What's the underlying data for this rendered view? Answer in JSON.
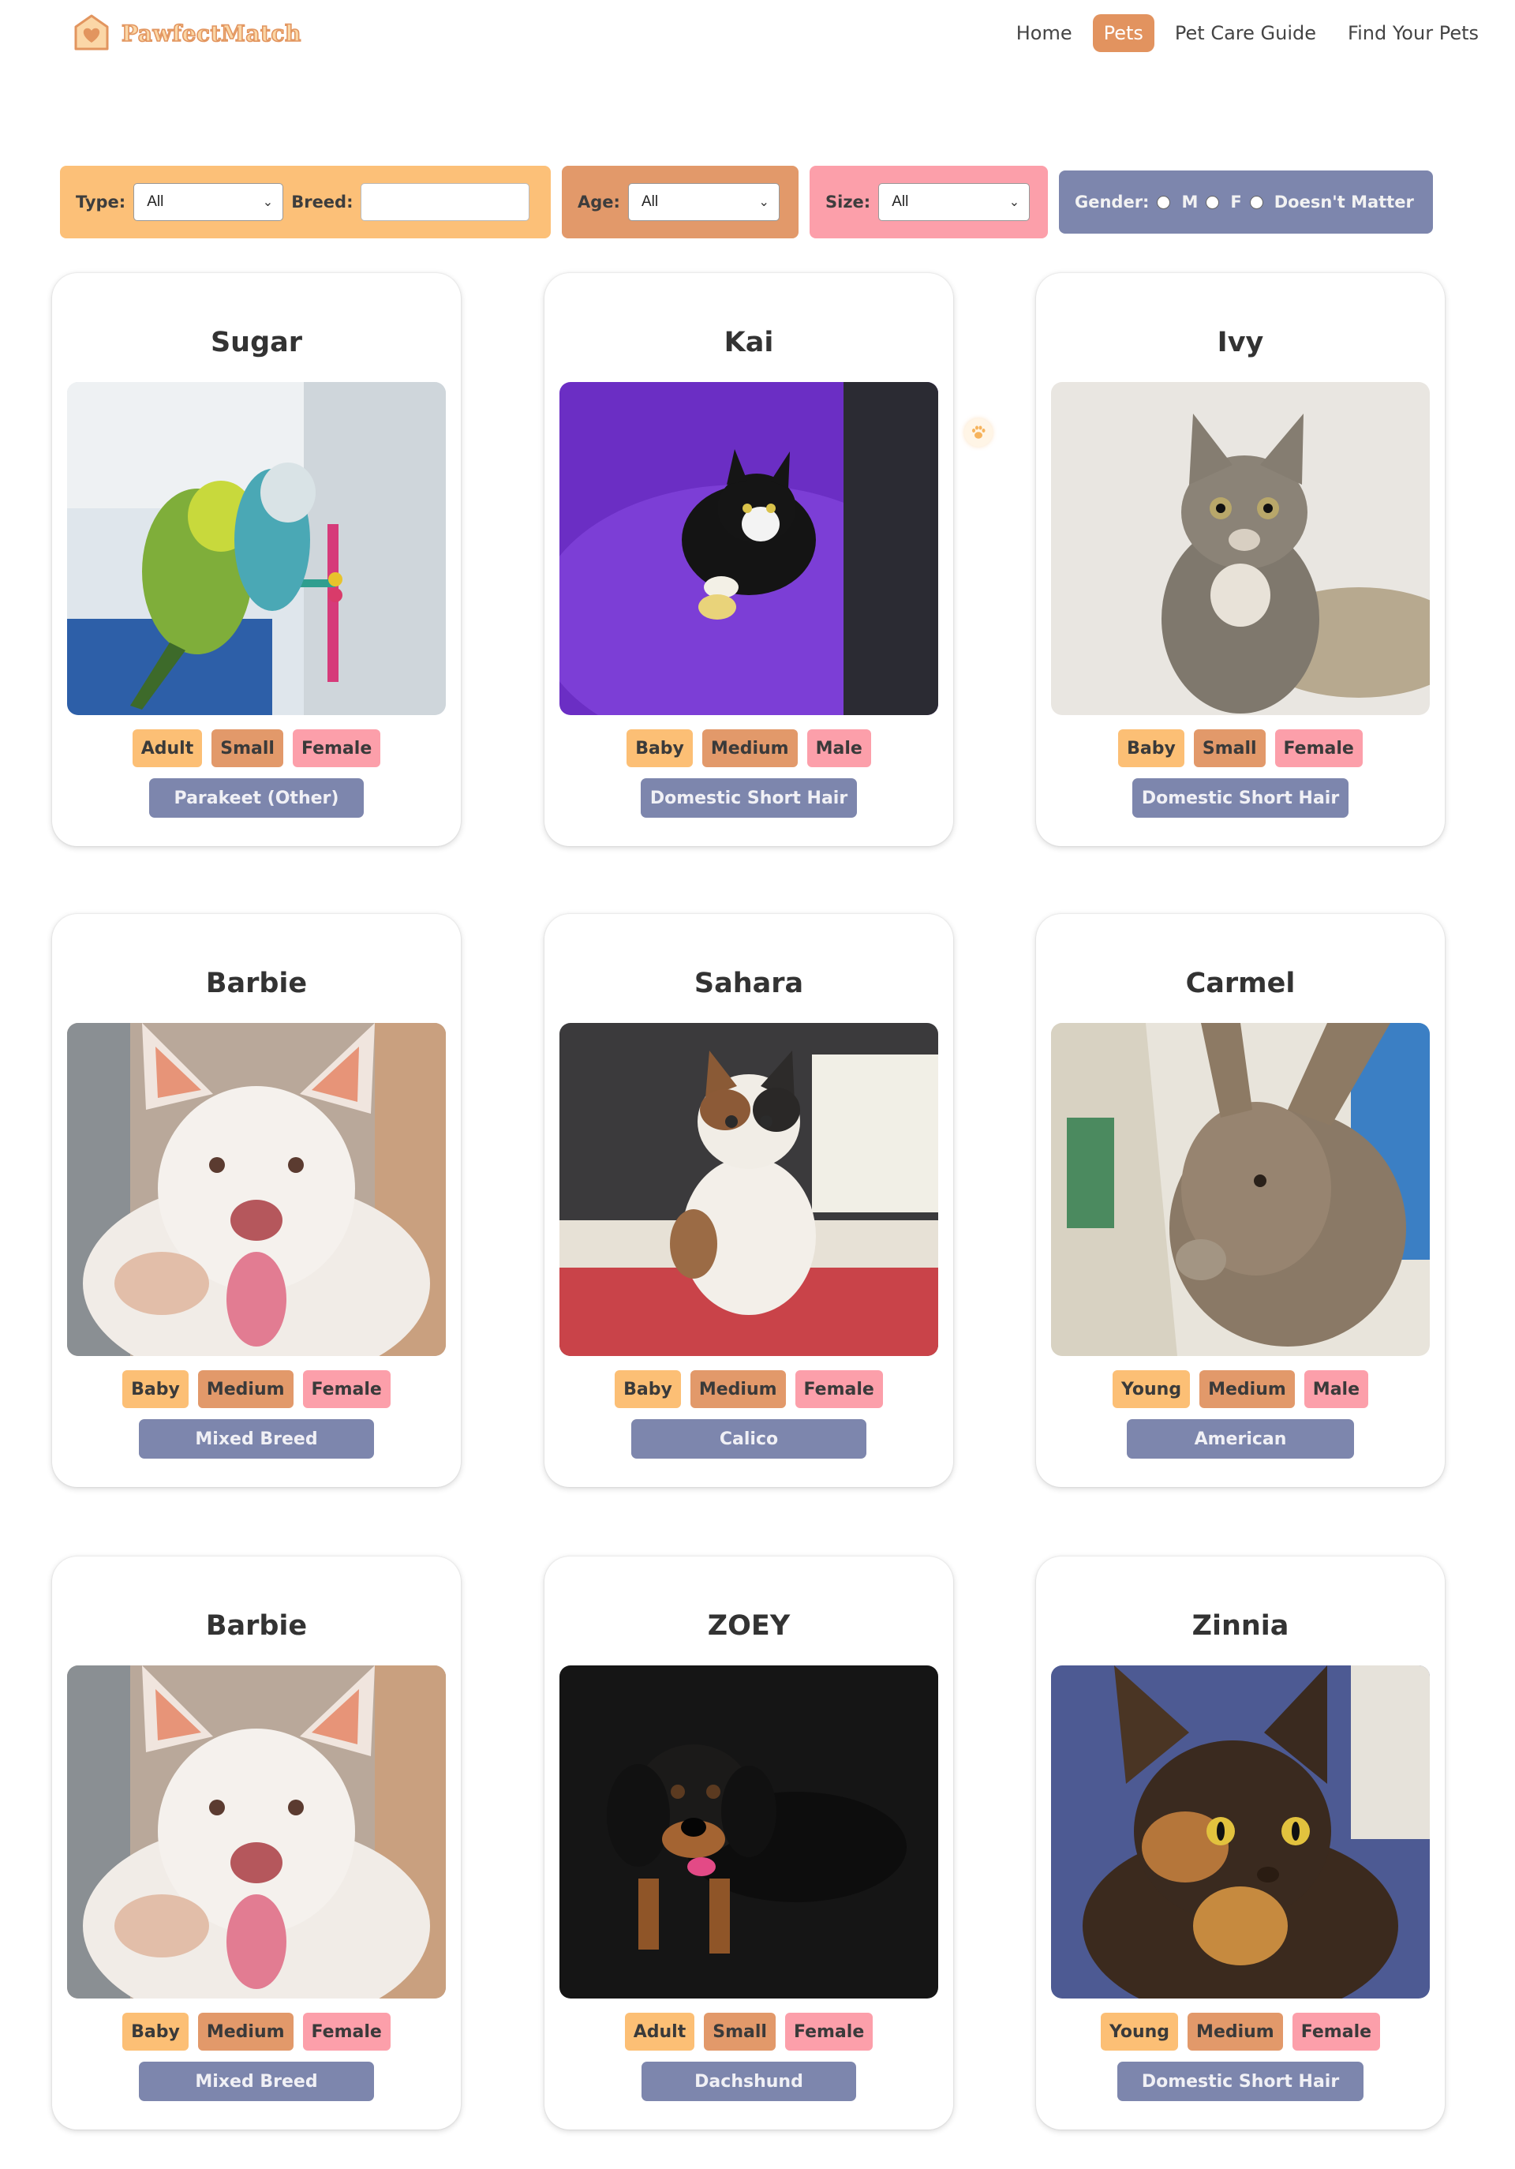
{
  "header": {
    "logo_text": "PawfectMatch",
    "nav": [
      "Home",
      "Pets",
      "Pet Care Guide",
      "Find Your Pets"
    ],
    "active_nav": "Pets",
    "accent": "#e2935f"
  },
  "filters": {
    "type_label": "Type:",
    "type_value": "All",
    "breed_label": "Breed:",
    "breed_value": "",
    "age_label": "Age:",
    "age_value": "All",
    "size_label": "Size:",
    "size_value": "All",
    "gender_label": "Gender:",
    "gender_options": [
      "M",
      "F",
      "Doesn't Matter"
    ]
  },
  "pets": [
    {
      "name": "Sugar",
      "age": "Adult",
      "size": "Small",
      "gender": "Female",
      "breed": "Parakeet (Other)",
      "photo": "parakeets"
    },
    {
      "name": "Kai",
      "age": "Baby",
      "size": "Medium",
      "gender": "Male",
      "breed": "Domestic Short Hair",
      "photo": "tuxedo-kitten"
    },
    {
      "name": "Ivy",
      "age": "Baby",
      "size": "Small",
      "gender": "Female",
      "breed": "Domestic Short Hair",
      "photo": "tabby-kitten"
    },
    {
      "name": "Barbie",
      "age": "Baby",
      "size": "Medium",
      "gender": "Female",
      "breed": "Mixed Breed",
      "photo": "white-puppy"
    },
    {
      "name": "Sahara",
      "age": "Baby",
      "size": "Medium",
      "gender": "Female",
      "breed": "Calico",
      "photo": "calico-kitten"
    },
    {
      "name": "Carmel",
      "age": "Young",
      "size": "Medium",
      "gender": "Male",
      "breed": "American",
      "photo": "rabbit"
    },
    {
      "name": "Barbie",
      "age": "Baby",
      "size": "Medium",
      "gender": "Female",
      "breed": "Mixed Breed",
      "photo": "white-puppy"
    },
    {
      "name": "ZOEY",
      "age": "Adult",
      "size": "Small",
      "gender": "Female",
      "breed": "Dachshund",
      "photo": "dachshund"
    },
    {
      "name": "Zinnia",
      "age": "Young",
      "size": "Medium",
      "gender": "Female",
      "breed": "Domestic Short Hair",
      "photo": "tortie-cat"
    }
  ]
}
